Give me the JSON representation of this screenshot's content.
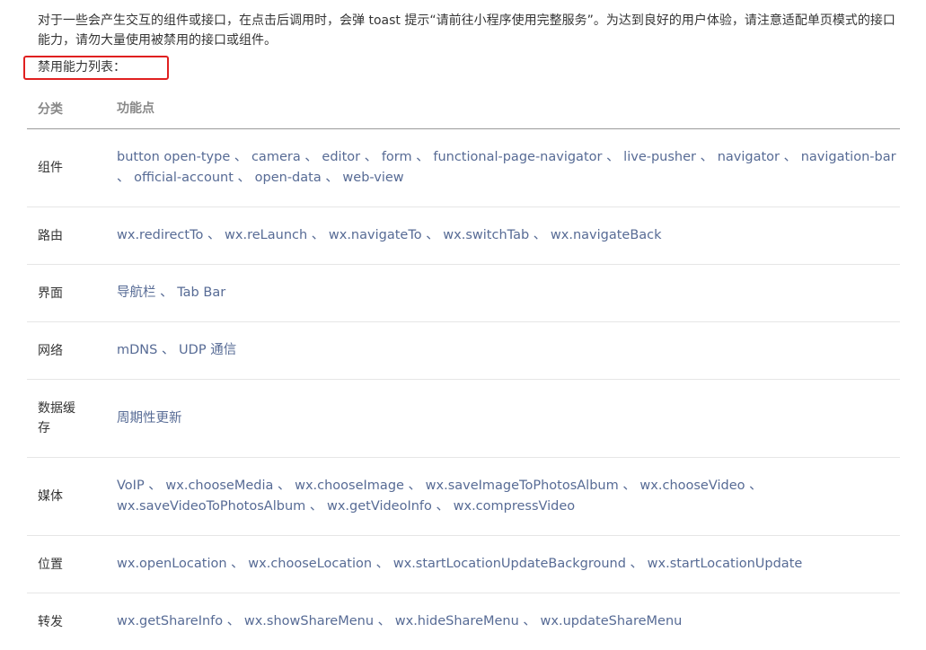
{
  "intro": "对于一些会产生交互的组件或接口，在点击后调用时，会弹 toast 提示“请前往小程序使用完整服务”。为达到良好的用户体验，请注意适配单页模式的接口能力，请勿大量使用被禁用的接口或组件。",
  "list_label": "禁用能力列表：",
  "table": {
    "headers": {
      "category": "分类",
      "features": "功能点"
    },
    "rows": [
      {
        "category": "组件",
        "features": "button open-type 、 camera 、 editor 、 form 、 functional-page-navigator 、 live-pusher 、 navigator 、 navigation-bar 、 official-account 、 open-data 、 web-view"
      },
      {
        "category": "路由",
        "features": "wx.redirectTo 、 wx.reLaunch 、 wx.navigateTo 、 wx.switchTab 、 wx.navigateBack"
      },
      {
        "category": "界面",
        "features": "导航栏 、 Tab Bar"
      },
      {
        "category": "网络",
        "features": "mDNS 、 UDP 通信"
      },
      {
        "category": "数据缓存",
        "features": "周期性更新"
      },
      {
        "category": "媒体",
        "features": "VoIP 、 wx.chooseMedia 、 wx.chooseImage 、 wx.saveImageToPhotosAlbum 、 wx.chooseVideo 、 wx.saveVideoToPhotosAlbum 、 wx.getVideoInfo 、 wx.compressVideo"
      },
      {
        "category": "位置",
        "features": "wx.openLocation 、 wx.chooseLocation 、 wx.startLocationUpdateBackground 、 wx.startLocationUpdate"
      },
      {
        "category": "转发",
        "features": "wx.getShareInfo 、 wx.showShareMenu 、 wx.hideShareMenu 、 wx.updateShareMenu"
      }
    ]
  },
  "colors": {
    "highlight_border": "#e02020",
    "link_text": "#576b95",
    "header_text": "#888888"
  }
}
